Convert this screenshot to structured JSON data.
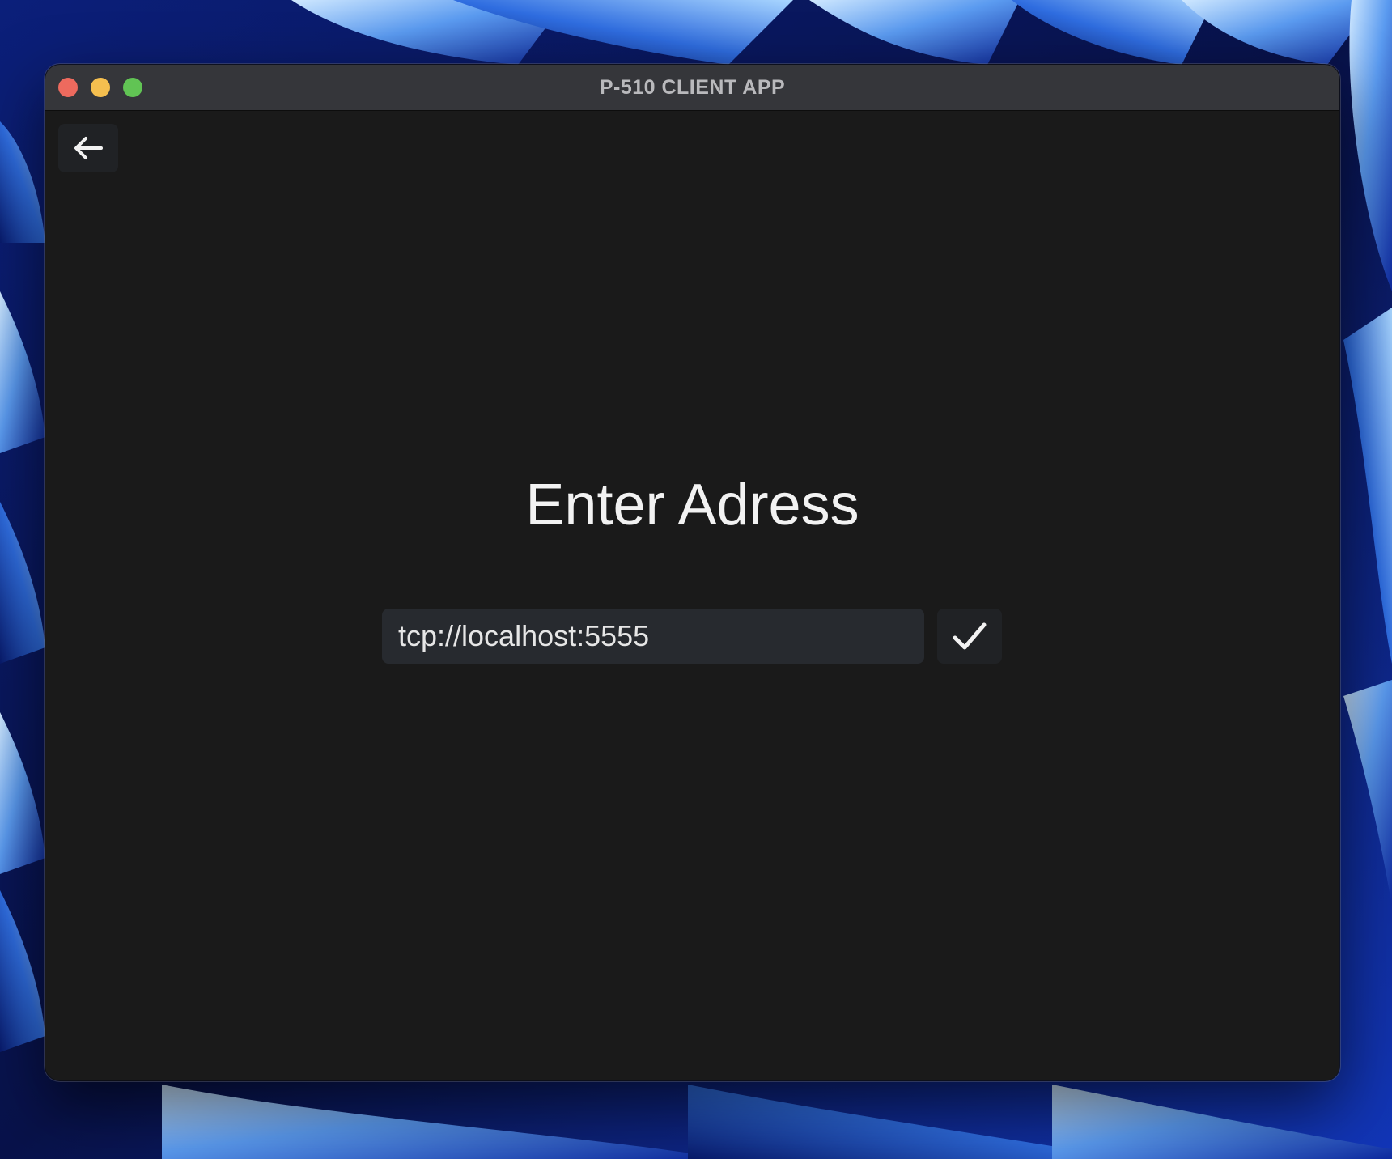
{
  "window": {
    "title": "P-510 CLIENT APP"
  },
  "toolbar": {
    "back_icon": "arrow-left-icon"
  },
  "main": {
    "heading": "Enter Adress",
    "address_input_value": "tcp://localhost:5555",
    "confirm_icon": "checkmark-icon"
  },
  "colors": {
    "window_background": "#1a1a1a",
    "titlebar_background": "#35363a",
    "input_background": "#272a2f",
    "button_background": "#202225",
    "close_light": "#ed6a5e",
    "minimize_light": "#f5bf4f",
    "zoom_light": "#61c454"
  }
}
